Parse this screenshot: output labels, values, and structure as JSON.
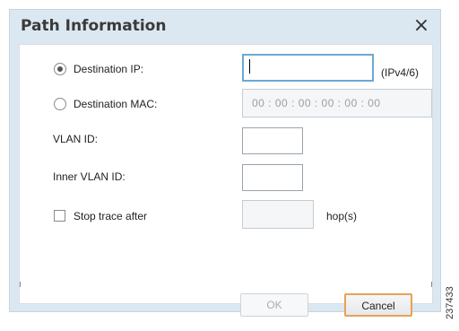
{
  "dialog": {
    "title": "Path Information",
    "close_icon": "×"
  },
  "fields": {
    "destination_ip": {
      "label": "Destination IP:",
      "value": "",
      "suffix": "(IPv4/6)"
    },
    "destination_mac": {
      "label": "Destination MAC:",
      "value": "00 : 00 : 00 : 00 : 00 : 00"
    },
    "vlan_id": {
      "label": "VLAN ID:",
      "value": ""
    },
    "inner_vlan_id": {
      "label": "Inner VLAN ID:",
      "value": ""
    },
    "stop_trace": {
      "label": "Stop trace after",
      "value": "",
      "suffix": "hop(s)"
    }
  },
  "buttons": {
    "ok": "OK",
    "cancel": "Cancel"
  },
  "side_code": "237433"
}
